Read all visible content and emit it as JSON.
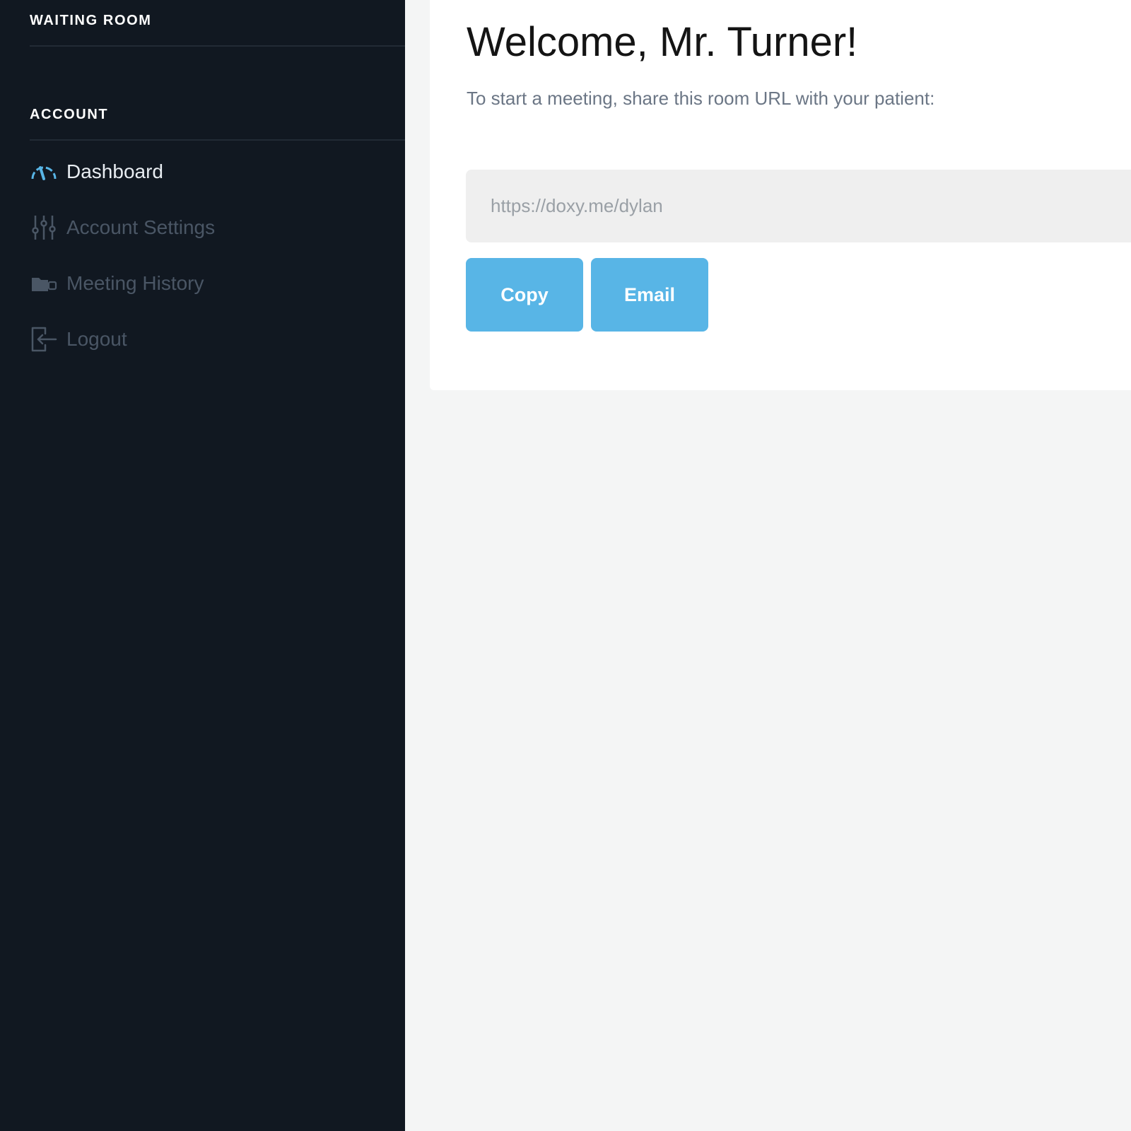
{
  "sidebar": {
    "waiting_room_heading": "WAITING ROOM",
    "account_heading": "ACCOUNT",
    "items": [
      {
        "label": "Dashboard",
        "icon": "dashboard-gauge-icon",
        "active": true
      },
      {
        "label": "Account Settings",
        "icon": "sliders-icon",
        "active": false
      },
      {
        "label": "Meeting History",
        "icon": "video-folder-icon",
        "active": false
      },
      {
        "label": "Logout",
        "icon": "logout-icon",
        "active": false
      }
    ]
  },
  "main": {
    "welcome": "Welcome, Mr. Turner!",
    "subtitle": "To start a meeting, share this room URL with your patient:",
    "room_url": "https://doxy.me/dylan",
    "copy_label": "Copy",
    "email_label": "Email"
  },
  "colors": {
    "sidebar_bg": "#111821",
    "accent": "#58b5e6",
    "page_bg": "#f4f5f5",
    "card_bg": "#ffffff"
  }
}
